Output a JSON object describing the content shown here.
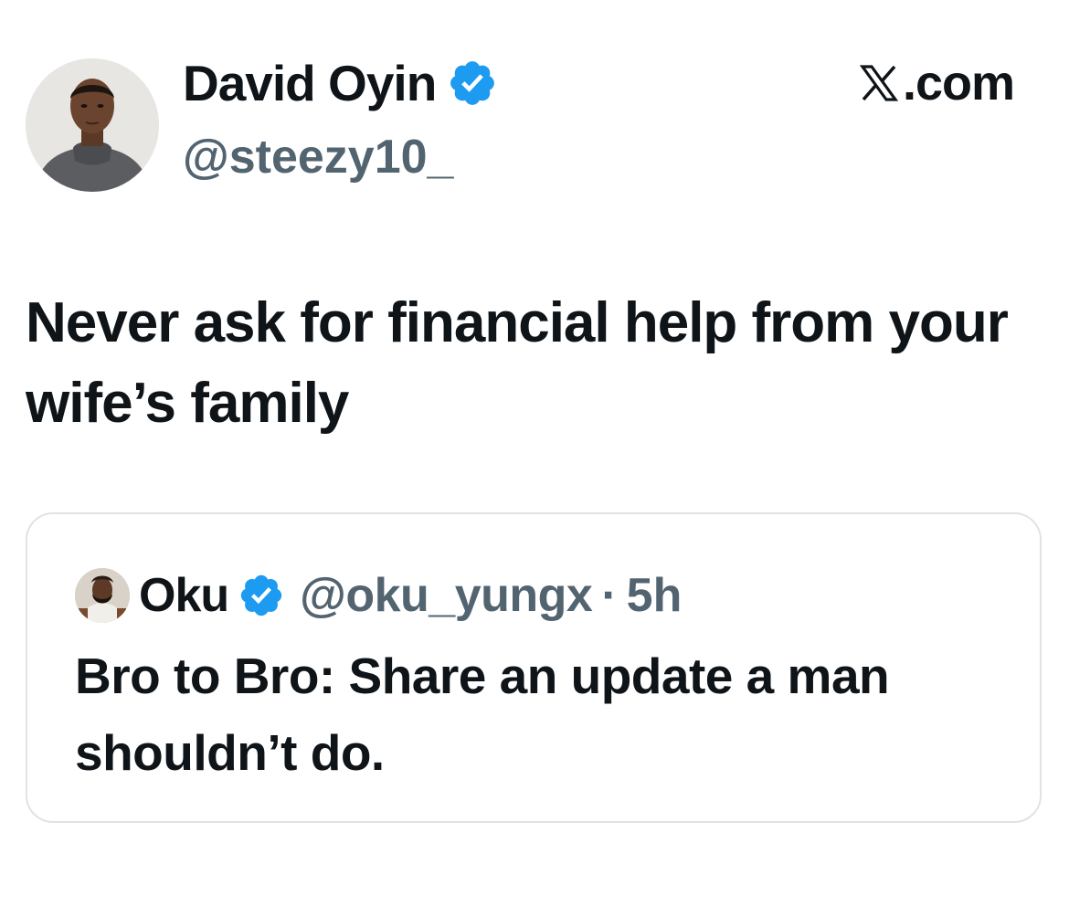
{
  "author": {
    "display_name": "David Oyin",
    "handle": "@steezy10_",
    "verified": true,
    "avatar_icon": "profile-photo"
  },
  "brand": {
    "logo_icon": "x-logo-icon",
    "text": ".com"
  },
  "tweet": {
    "text": "Never ask for financial help from your wife’s family"
  },
  "quoted_tweet": {
    "display_name": "Oku",
    "handle": "@oku_yungx",
    "separator": "·",
    "time": "5h",
    "verified": true,
    "text": "Bro to Bro: Share an update a man shouldn’t do."
  },
  "colors": {
    "text_primary": "#0f1419",
    "text_secondary": "#536471",
    "verified_blue": "#1d9bf0",
    "card_border": "#dfe3e6"
  }
}
